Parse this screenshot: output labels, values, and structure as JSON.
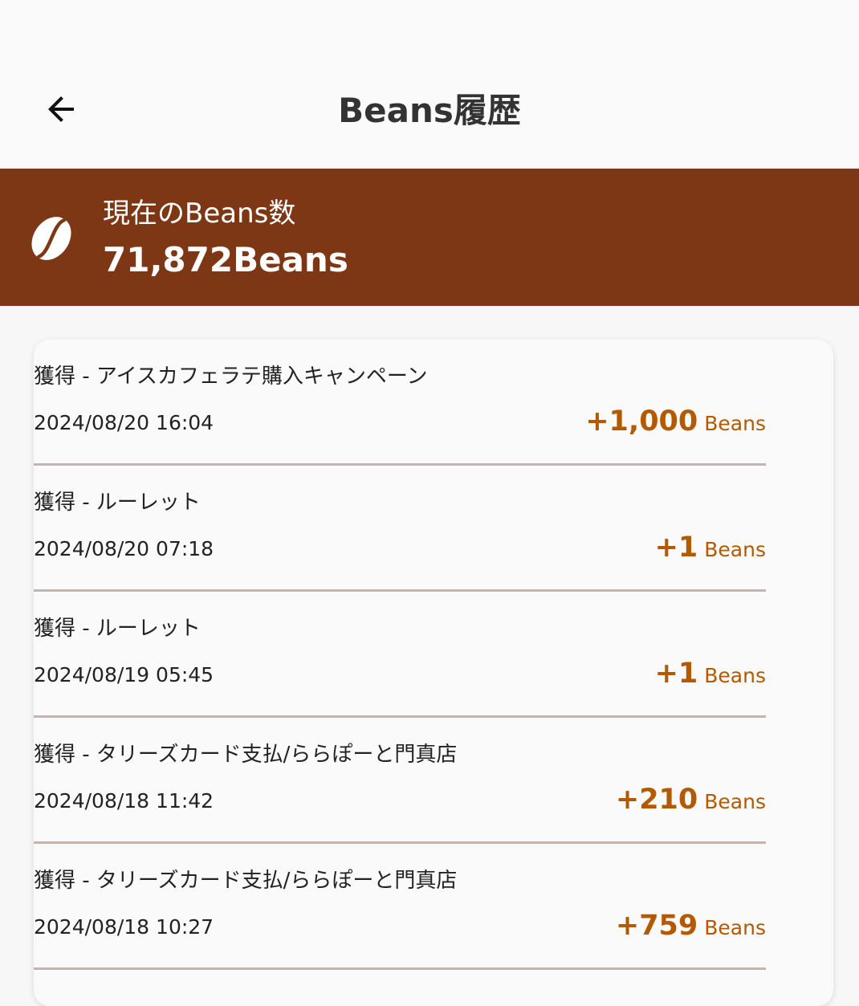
{
  "header": {
    "title": "Beans履歴",
    "back_icon": "arrow-left-icon"
  },
  "balance": {
    "icon": "coffee-bean-icon",
    "label": "現在のBeans数",
    "value": "71,872Beans"
  },
  "history": [
    {
      "title": "獲得 - アイスカフェラテ購入キャンペーン",
      "date": "2024/08/20 16:04",
      "amount": "+1,000",
      "unit": "Beans"
    },
    {
      "title": "獲得 - ルーレット",
      "date": "2024/08/20 07:18",
      "amount": "+1",
      "unit": "Beans"
    },
    {
      "title": "獲得 - ルーレット",
      "date": "2024/08/19 05:45",
      "amount": "+1",
      "unit": "Beans"
    },
    {
      "title": "獲得 - タリーズカード支払/ららぽーと門真店",
      "date": "2024/08/18 11:42",
      "amount": "+210",
      "unit": "Beans"
    },
    {
      "title": "獲得 - タリーズカード支払/ららぽーと門真店",
      "date": "2024/08/18 10:27",
      "amount": "+759",
      "unit": "Beans"
    }
  ],
  "colors": {
    "banner": "#7e3714",
    "amount": "#b35900",
    "divider": "#c2b4ae"
  }
}
